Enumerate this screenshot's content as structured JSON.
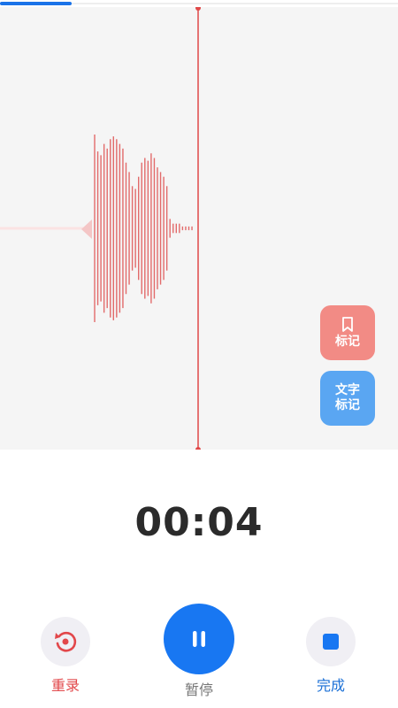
{
  "progress": {
    "fraction": 0.18
  },
  "waveform": {
    "color": "#e26a6a",
    "bars": [
      1,
      0.82,
      0.78,
      0.9,
      0.85,
      0.95,
      0.98,
      0.95,
      0.9,
      0.85,
      0.7,
      0.6,
      0.45,
      0.42,
      0.55,
      0.7,
      0.75,
      0.72,
      0.8,
      0.75,
      0.65,
      0.6,
      0.55,
      0.45,
      0.1,
      0.05,
      0.05,
      0.05,
      0.02,
      0.02,
      0.02,
      0.02
    ]
  },
  "side_buttons": {
    "bookmark_label": "标记",
    "text_label_line1": "文字",
    "text_label_line2": "标记"
  },
  "timer": "00:04",
  "controls": {
    "rerecord_label": "重录",
    "pause_label": "暂停",
    "finish_label": "完成"
  },
  "colors": {
    "accent_blue": "#1877f2",
    "playhead_red": "#e04848",
    "bookmark_bg": "#f28b85",
    "text_mark_bg": "#5aa6f2"
  }
}
